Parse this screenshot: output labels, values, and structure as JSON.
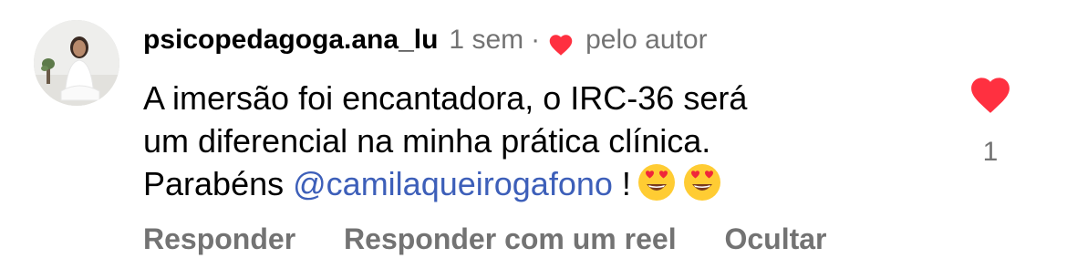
{
  "comment": {
    "username": "psicopedagoga.ana_lu",
    "time": "1 sem",
    "separator": "·",
    "liked_by_author_label": "pelo autor",
    "line1": "A imersão foi encantadora, o IRC-36 será",
    "line2": "um diferencial na minha prática clínica.",
    "line3_prefix": "Parabéns",
    "mention": "@camilaqueirogafono",
    "line3_suffix": "!",
    "emojis": [
      "heart-eyes-emoji",
      "heart-eyes-emoji"
    ]
  },
  "actions": {
    "reply": "Responder",
    "reply_reel": "Responder com um reel",
    "hide": "Ocultar"
  },
  "likes": {
    "count": "1",
    "icon": "heart-icon",
    "color": "#ff3040"
  },
  "colors": {
    "mention": "#3d5fb9",
    "secondary_text": "#737373"
  }
}
